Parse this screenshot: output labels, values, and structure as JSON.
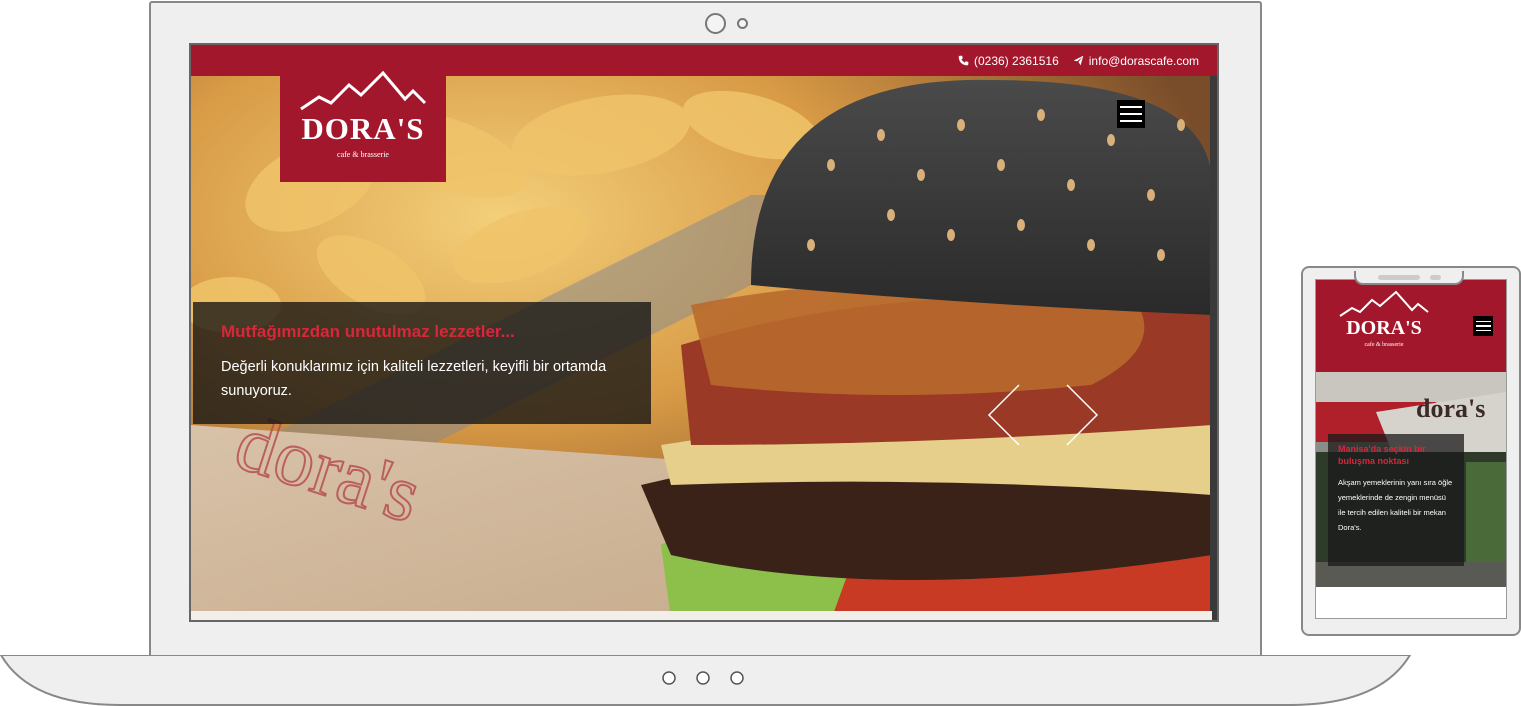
{
  "desktop": {
    "topbar": {
      "phone": "(0236) 2361516",
      "email": "info@dorascafe.com"
    },
    "logo": {
      "brand": "DORA'S",
      "tagline": "cafe & brasserie"
    },
    "slide": {
      "title": "Mutfağımızdan unutulmaz lezzetler...",
      "text": "Değerli konuklarımız için kaliteli lezzetleri, keyifli bir ortamda sunuyoruz."
    }
  },
  "mobile": {
    "logo": {
      "brand": "DORA'S",
      "tagline": "cafe & brasserie"
    },
    "slide": {
      "title": "Manisa'da seçkin bir buluşma noktası",
      "text": "Akşam yemeklerinin yanı sıra öğle yemeklerinde de zengin menüsü ile tercih edilen kaliteli bir mekan Dora's."
    }
  },
  "colors": {
    "brand": "#a3172c",
    "accent_text": "#d9263a"
  },
  "icons": [
    "phone-icon",
    "paper-plane-icon",
    "hamburger-menu-icon",
    "chevron-left-icon",
    "chevron-right-icon"
  ]
}
